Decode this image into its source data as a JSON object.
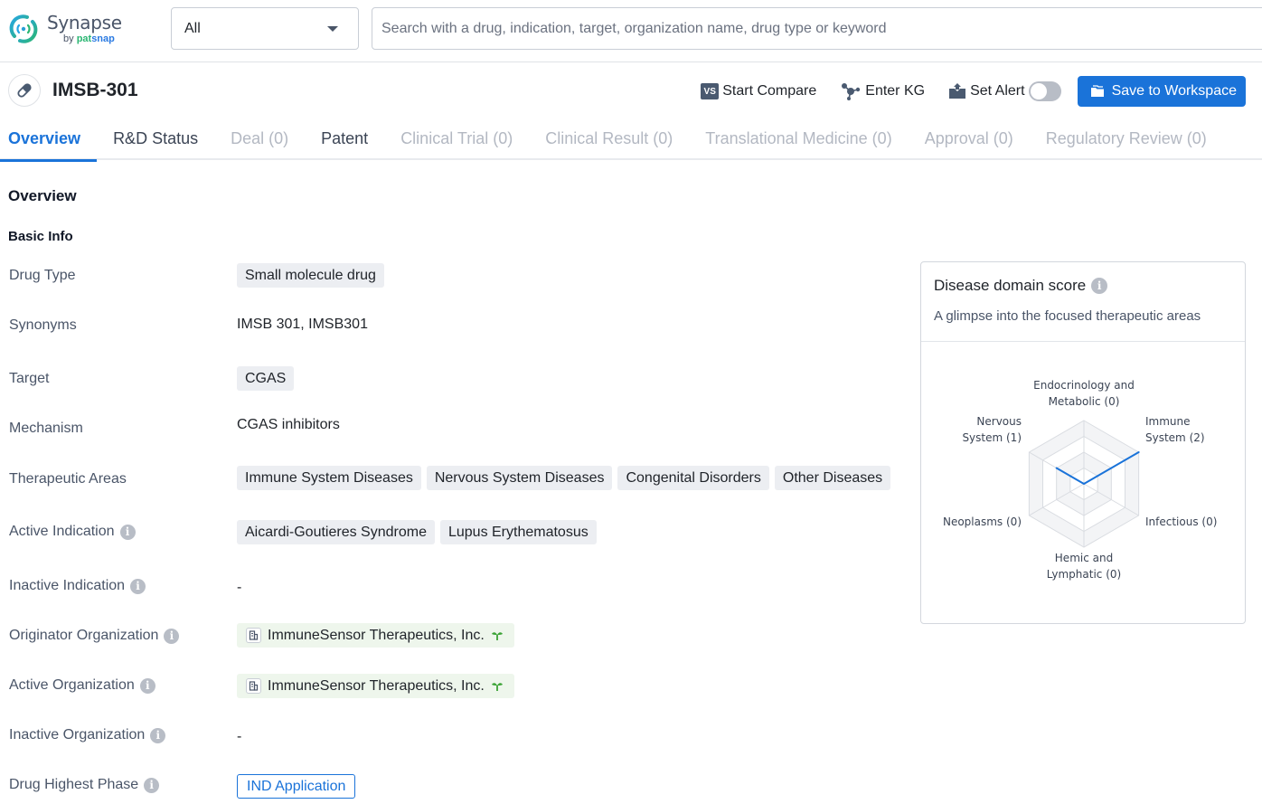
{
  "app": {
    "name": "Synapse",
    "by": "by",
    "brand_a": "pat",
    "brand_b": "snap"
  },
  "search": {
    "scope_value": "All",
    "placeholder": "Search with a drug, indication, target, organization name, drug type or keyword"
  },
  "drug": {
    "title": "IMSB-301"
  },
  "actions": {
    "compare_badge": "VS",
    "start_compare": "Start Compare",
    "enter_kg": "Enter KG",
    "set_alert": "Set Alert",
    "set_alert_on": false,
    "save_workspace": "Save to Workspace"
  },
  "tabs": [
    {
      "label": "Overview",
      "state": "active"
    },
    {
      "label": "R&D Status",
      "state": "enabled"
    },
    {
      "label": "Deal (0)",
      "state": "disabled"
    },
    {
      "label": "Patent",
      "state": "enabled"
    },
    {
      "label": "Clinical Trial (0)",
      "state": "disabled"
    },
    {
      "label": "Clinical Result (0)",
      "state": "disabled"
    },
    {
      "label": "Translational Medicine (0)",
      "state": "disabled"
    },
    {
      "label": "Approval (0)",
      "state": "disabled"
    },
    {
      "label": "Regulatory Review (0)",
      "state": "disabled"
    }
  ],
  "overview": {
    "title": "Overview",
    "basic_info_title": "Basic Info",
    "fields": {
      "drug_type": {
        "label": "Drug Type",
        "tags": [
          "Small molecule drug"
        ]
      },
      "synonyms": {
        "label": "Synonyms",
        "text": "IMSB 301,  IMSB301"
      },
      "target": {
        "label": "Target",
        "tags": [
          "CGAS"
        ]
      },
      "mechanism": {
        "label": "Mechanism",
        "text": "CGAS inhibitors"
      },
      "therapeutic_areas": {
        "label": "Therapeutic Areas",
        "tags": [
          "Immune System Diseases",
          "Nervous System Diseases",
          "Congenital Disorders",
          "Other Diseases"
        ]
      },
      "active_indication": {
        "label": "Active Indication",
        "tags": [
          "Aicardi-Goutieres Syndrome",
          "Lupus Erythematosus"
        ]
      },
      "inactive_indication": {
        "label": "Inactive Indication",
        "text": "-"
      },
      "originator_org": {
        "label": "Originator Organization",
        "org": "ImmuneSensor Therapeutics, Inc."
      },
      "active_org": {
        "label": "Active Organization",
        "org": "ImmuneSensor Therapeutics, Inc."
      },
      "inactive_org": {
        "label": "Inactive Organization",
        "text": "-"
      },
      "highest_phase": {
        "label": "Drug Highest Phase",
        "phase": "IND Application"
      }
    }
  },
  "disease_domain": {
    "title": "Disease domain score",
    "subtitle": "A glimpse into the focused therapeutic areas",
    "colors": {
      "series": "#1a73d9",
      "grid": "#d9dce1",
      "band": "#f3f4f6"
    }
  },
  "chart_data": {
    "type": "radar",
    "title": "Disease domain score",
    "axes": [
      {
        "label_lines": [
          "Endocrinology and",
          "Metabolic (0)"
        ],
        "name": "Endocrinology and Metabolic",
        "value": 0
      },
      {
        "label_lines": [
          "Immune",
          "System (2)"
        ],
        "name": "Immune System",
        "value": 2
      },
      {
        "label_lines": [
          "Infectious (0)"
        ],
        "name": "Infectious",
        "value": 0
      },
      {
        "label_lines": [
          "Hemic and",
          "Lymphatic (0)"
        ],
        "name": "Hemic and Lymphatic",
        "value": 0
      },
      {
        "label_lines": [
          "Neoplasms (0)"
        ],
        "name": "Neoplasms",
        "value": 0
      },
      {
        "label_lines": [
          "Nervous",
          "System (1)"
        ],
        "name": "Nervous System",
        "value": 1
      }
    ],
    "range": [
      0,
      2
    ],
    "rings": 4,
    "series": [
      {
        "name": "score",
        "values": [
          0,
          2,
          0,
          0,
          0,
          1
        ]
      }
    ]
  }
}
